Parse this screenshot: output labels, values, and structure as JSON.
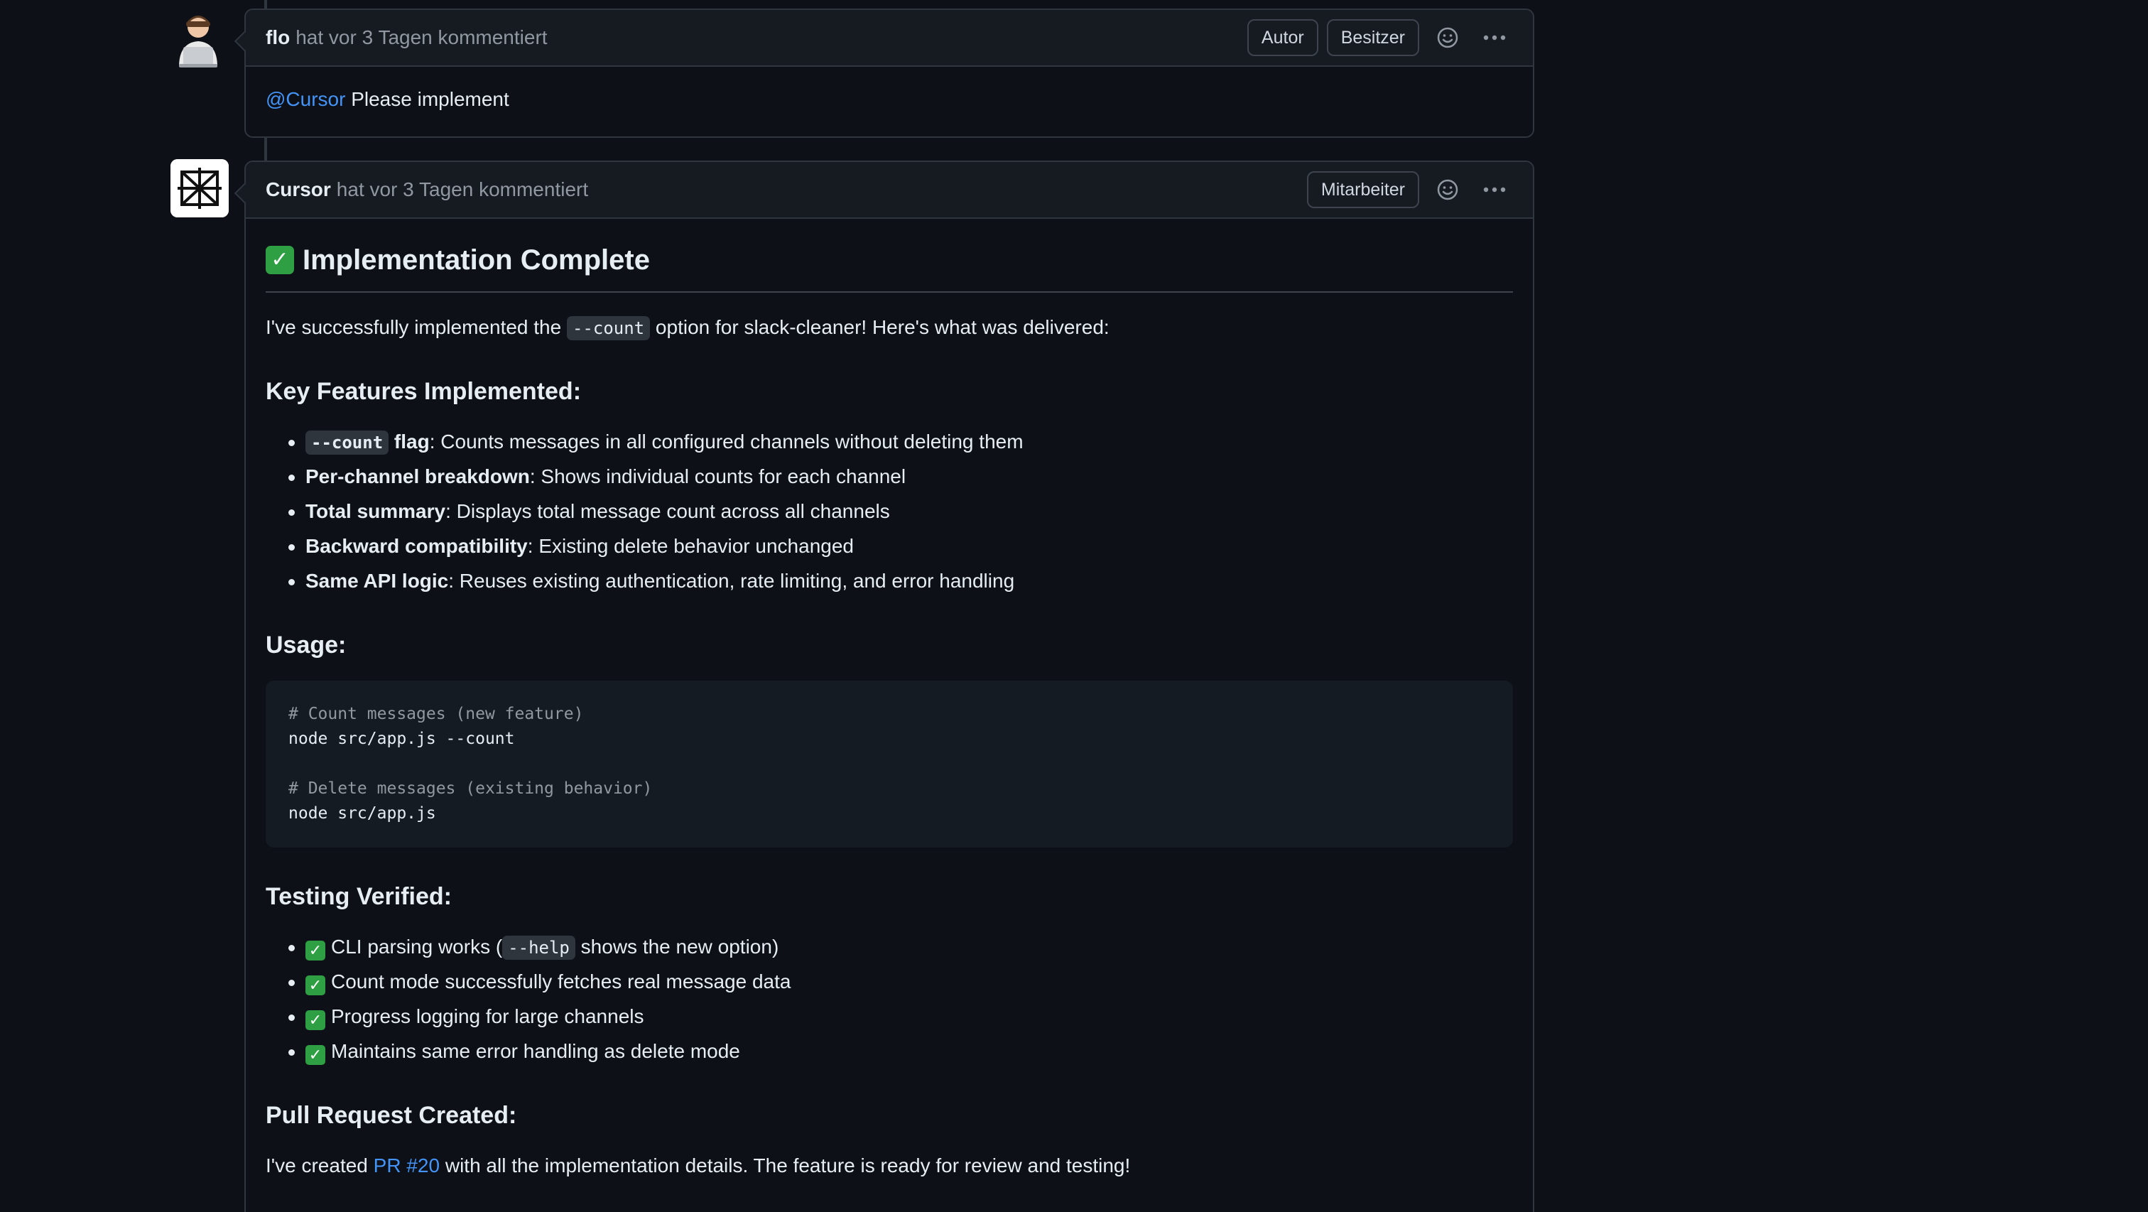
{
  "comment1": {
    "author": "flo",
    "meta": "hat vor 3 Tagen kommentiert",
    "badges": [
      "Autor",
      "Besitzer"
    ],
    "mention": "@Cursor",
    "body_text": " Please implement",
    "emoji_icon": "smiley-icon",
    "more_icon": "kebab-icon"
  },
  "comment2": {
    "author": "Cursor",
    "meta": "hat vor 3 Tagen kommentiert",
    "badge": "Mitarbeiter",
    "heading": "Implementation Complete",
    "intro": {
      "before": "I've successfully implemented the ",
      "code": "--count",
      "after": " option for slack-cleaner! Here's what was delivered:"
    },
    "features_heading": "Key Features Implemented:",
    "features": [
      {
        "code": "--count",
        "bold": " flag",
        "text": ": Counts messages in all configured channels without deleting them"
      },
      {
        "bold": "Per-channel breakdown",
        "text": ": Shows individual counts for each channel"
      },
      {
        "bold": "Total summary",
        "text": ": Displays total message count across all channels"
      },
      {
        "bold": "Backward compatibility",
        "text": ": Existing delete behavior unchanged"
      },
      {
        "bold": "Same API logic",
        "text": ": Reuses existing authentication, rate limiting, and error handling"
      }
    ],
    "usage_heading": "Usage:",
    "code_lines": [
      {
        "text": "# Count messages (new feature)",
        "comment": true
      },
      {
        "text": "node src/app.js --count",
        "comment": false
      },
      {
        "text": "",
        "comment": false
      },
      {
        "text": "# Delete messages (existing behavior)",
        "comment": true
      },
      {
        "text": "node src/app.js",
        "comment": false
      }
    ],
    "testing_heading": "Testing Verified:",
    "testing": {
      "item1_before": "CLI parsing works (",
      "item1_code": "--help",
      "item1_after": " shows the new option)",
      "item2": "Count mode successfully fetches real message data",
      "item3": "Progress logging for large channels",
      "item4": "Maintains same error handling as delete mode"
    },
    "pr_heading": "Pull Request Created:",
    "pr": {
      "before": "I've created ",
      "link": "PR #20",
      "after": " with all the implementation details. The feature is ready for review and testing!"
    }
  },
  "colors": {
    "background": "#0d1117",
    "header": "#161b22",
    "border": "#30363d",
    "link": "#4493f8",
    "check": "#2ea043"
  }
}
